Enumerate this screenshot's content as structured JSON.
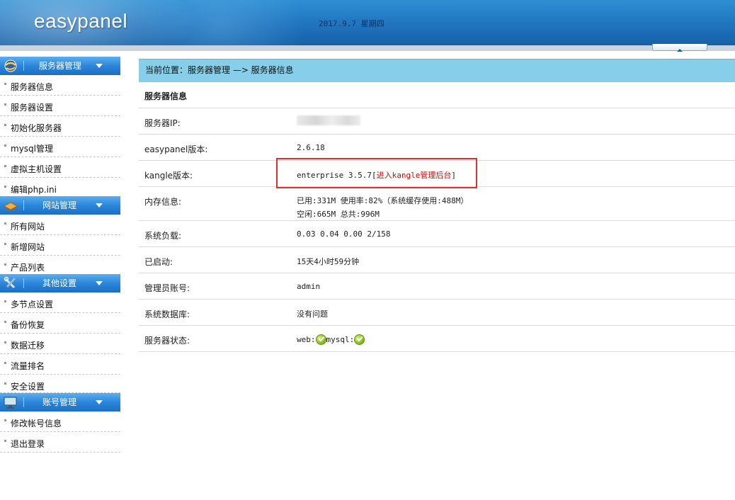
{
  "header": {
    "logo": "easypanel",
    "date": "2017.9.7 星期四"
  },
  "sidebar": {
    "groups": [
      {
        "title": "服务器管理",
        "icon": "server-icon",
        "items": [
          "服务器信息",
          "服务器设置",
          "初始化服务器",
          "mysql管理",
          "虚拟主机设置",
          "编辑php.ini"
        ]
      },
      {
        "title": "网站管理",
        "icon": "book-icon",
        "items": [
          "所有网站",
          "新增网站",
          "产品列表"
        ]
      },
      {
        "title": "其他设置",
        "icon": "tools-icon",
        "items": [
          "多节点设置",
          "备份恢复",
          "数据迁移",
          "流量排名",
          "安全设置"
        ]
      },
      {
        "title": "账号管理",
        "icon": "monitor-icon",
        "items": [
          "修改帐号信息",
          "退出登录"
        ]
      }
    ]
  },
  "breadcrumb": "当前位置：服务器管理 —> 服务器信息",
  "info": {
    "title": "服务器信息",
    "ip_label": "服务器IP:",
    "version_label": "easypanel版本:",
    "version_value": "2.6.18",
    "kangle_label": "kangle版本:",
    "kangle_value": "enterprise 3.5.7[",
    "kangle_link": "进入kangle管理后台",
    "kangle_close": "]",
    "memory_label": "内存信息:",
    "memory_line1": "已用:331M 使用率:82%（系统缓存使用:488M）",
    "memory_line2": "空闲:665M 总共:996M",
    "load_label": "系统负载:",
    "load_value": "0.03 0.04 0.00 2/158",
    "uptime_label": "已启动:",
    "uptime_value": "15天4小时59分钟",
    "admin_label": "管理员账号:",
    "admin_value": "admin",
    "db_label": "系统数据库:",
    "db_value": "没有问题",
    "status_label": "服务器状态:",
    "status_web": "web:",
    "status_mysql": "mysql:"
  },
  "colors": {
    "header": "#1f73bd",
    "breadcrumb_bg": "#87cfe8",
    "highlight": "#e23030",
    "link": "#e00000",
    "ok": "#1a8a1a"
  }
}
